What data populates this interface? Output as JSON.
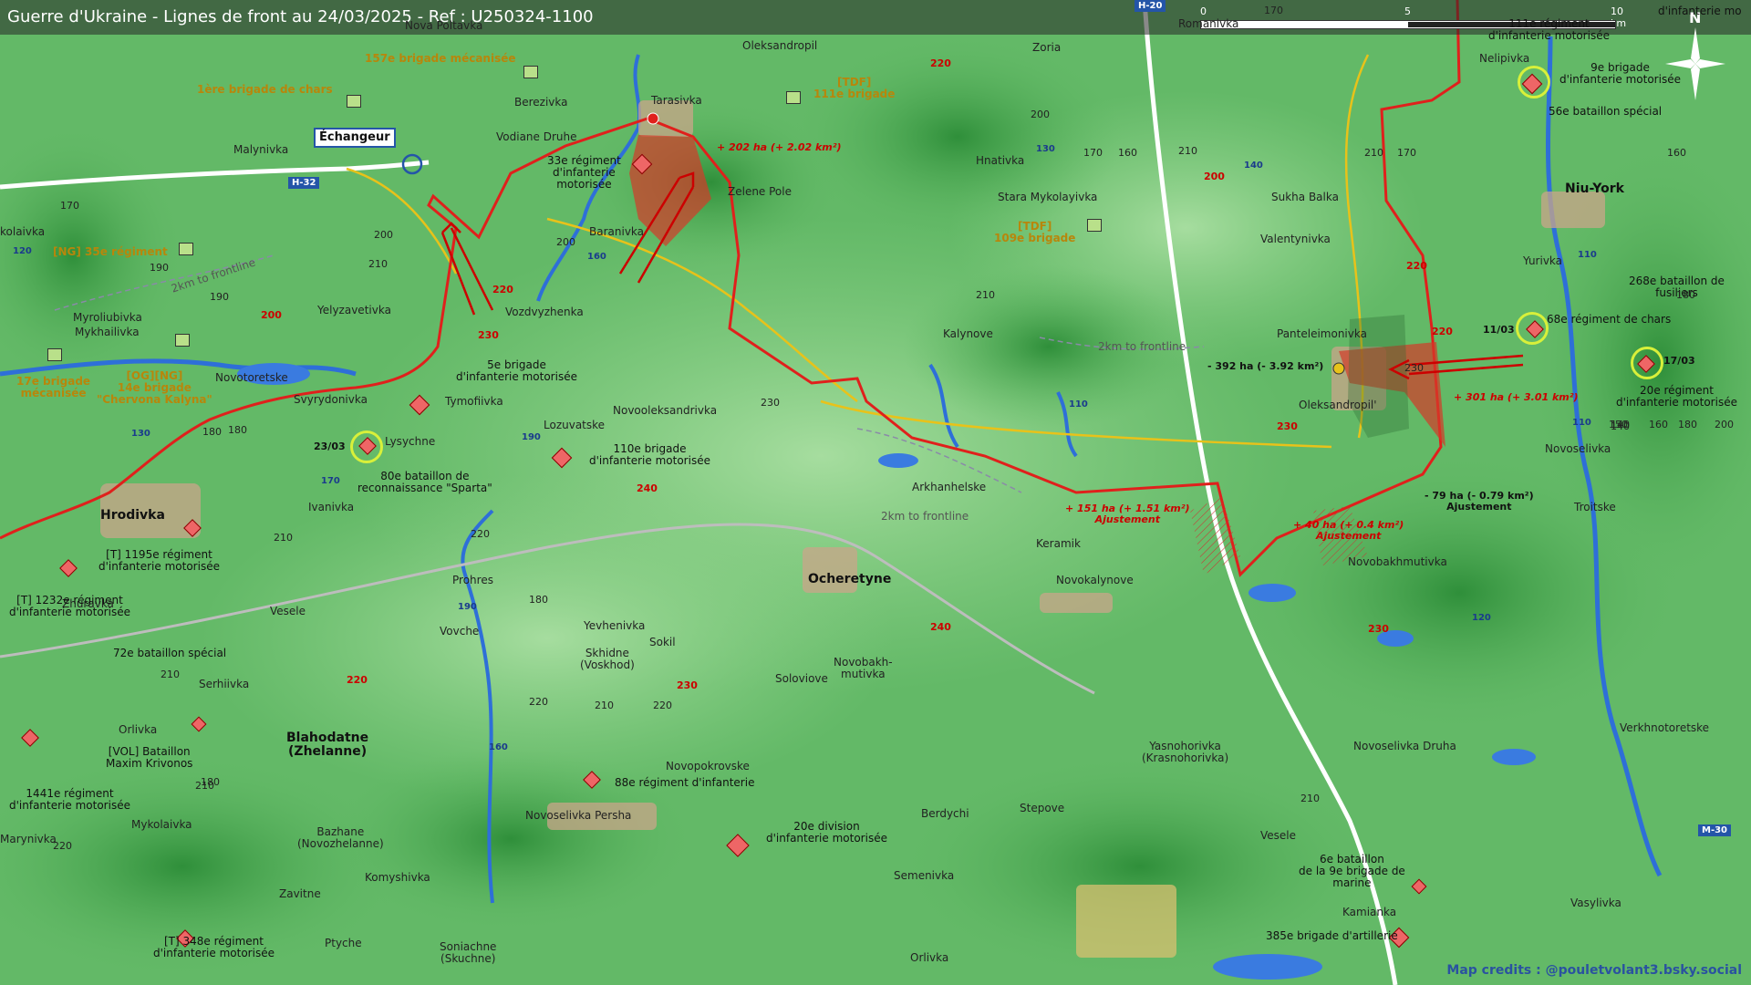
{
  "header": {
    "title": "Guerre d'Ukraine - Lignes de front au 24/03/2025 - Ref : U250324-1100"
  },
  "scale": {
    "zero": "0",
    "mid": "5",
    "end": "10 km"
  },
  "compass": {
    "north": "N"
  },
  "credits": "Map credits : @pouletvolant3.bsky.social",
  "interchange": "Échangeur",
  "road_labels": [
    {
      "id": "h32",
      "text": "H-32"
    },
    {
      "id": "h20",
      "text": "H-20"
    },
    {
      "id": "m30",
      "text": "M-30"
    }
  ],
  "towns": [
    {
      "id": "romanivka",
      "text": "Romanivka"
    },
    {
      "id": "nova-poltavka",
      "text": "Nova Poltavka"
    },
    {
      "id": "oleksandropil-n",
      "text": "Oleksandropil"
    },
    {
      "id": "zoria",
      "text": "Zoria"
    },
    {
      "id": "nelipivka",
      "text": "Nelipivka"
    },
    {
      "id": "berezivka",
      "text": "Berezivka"
    },
    {
      "id": "tarasivka",
      "text": "Tarasivka"
    },
    {
      "id": "malynivka",
      "text": "Malynivka"
    },
    {
      "id": "vodiane",
      "text": "Vodiane Druhe"
    },
    {
      "id": "zelene",
      "text": "Zelene Pole"
    },
    {
      "id": "hnativka",
      "text": "Hnativka"
    },
    {
      "id": "stara-myk",
      "text": "Stara Mykolayivka"
    },
    {
      "id": "sukha",
      "text": "Sukha Balka"
    },
    {
      "id": "valentynivka",
      "text": "Valentynivka"
    },
    {
      "id": "yurivka",
      "text": "Yurivka"
    },
    {
      "id": "baranivka",
      "text": "Baranivka"
    },
    {
      "id": "vozdvyzh",
      "text": "Vozdvyzhenka"
    },
    {
      "id": "yelyzav",
      "text": "Yelyzavetivka"
    },
    {
      "id": "myrolub",
      "text": "Myroliubivka"
    },
    {
      "id": "mykhailivka",
      "text": "Mykhailivka"
    },
    {
      "id": "kalynove",
      "text": "Kalynove"
    },
    {
      "id": "panteleim",
      "text": "Panteleimonivka"
    },
    {
      "id": "novotoretske",
      "text": "Novotoretske"
    },
    {
      "id": "svyrydonivka",
      "text": "Svyrydonivka"
    },
    {
      "id": "tymofiivka",
      "text": "Tymofiivka"
    },
    {
      "id": "novooleks",
      "text": "Novooleksandrivka"
    },
    {
      "id": "oleksandropil-e",
      "text": "Oleksandropil'"
    },
    {
      "id": "lozuvatske",
      "text": "Lozuvatske"
    },
    {
      "id": "lysychne",
      "text": "Lysychne"
    },
    {
      "id": "novoselivka",
      "text": "Novoselivka"
    },
    {
      "id": "arkhanh",
      "text": "Arkhanhelske"
    },
    {
      "id": "ivanivka",
      "text": "Ivanivka"
    },
    {
      "id": "troitske",
      "text": "Troitske"
    },
    {
      "id": "keramik",
      "text": "Keramik"
    },
    {
      "id": "novokalynove",
      "text": "Novokalynove"
    },
    {
      "id": "novobakh",
      "text": "Novobakhmutivka"
    },
    {
      "id": "prohres",
      "text": "Prohres"
    },
    {
      "id": "vesele-w",
      "text": "Vesele"
    },
    {
      "id": "zhuravka",
      "text": "Zhuravka"
    },
    {
      "id": "vovche",
      "text": "Vovche"
    },
    {
      "id": "yevhenivka",
      "text": "Yevhenivka"
    },
    {
      "id": "sokil",
      "text": "Sokil"
    },
    {
      "id": "skhidne",
      "text": "Skhidne\n(Voskhod)"
    },
    {
      "id": "novobakh-m",
      "text": "Novobakh-\nmutivka"
    },
    {
      "id": "soloviove",
      "text": "Soloviove"
    },
    {
      "id": "serhiivka",
      "text": "Serhiivka"
    },
    {
      "id": "orlivka-w",
      "text": "Orlivka"
    },
    {
      "id": "novopokr",
      "text": "Novopokrovske"
    },
    {
      "id": "yasnohor",
      "text": "Yasnohorivka\n(Krasnohorivka)"
    },
    {
      "id": "novos-druha",
      "text": "Novoselivka Druha"
    },
    {
      "id": "verkhnotor",
      "text": "Verkhnotoretske"
    },
    {
      "id": "novos-persha",
      "text": "Novoselivka Persha"
    },
    {
      "id": "mykolaivka",
      "text": "Mykolaivka"
    },
    {
      "id": "berdychi",
      "text": "Berdychi"
    },
    {
      "id": "stepove",
      "text": "Stepove"
    },
    {
      "id": "bazhane",
      "text": "Bazhane\n(Novozhelanne)"
    },
    {
      "id": "vesele-e",
      "text": "Vesele"
    },
    {
      "id": "semenivka",
      "text": "Semenivka"
    },
    {
      "id": "marynivka",
      "text": "Marynivka"
    },
    {
      "id": "komyshivka",
      "text": "Komyshivka"
    },
    {
      "id": "zavitne",
      "text": "Zavitne"
    },
    {
      "id": "kamianka",
      "text": "Kamianka"
    },
    {
      "id": "vasylivka",
      "text": "Vasylivka"
    },
    {
      "id": "ptyche",
      "text": "Ptyche"
    },
    {
      "id": "soniachne",
      "text": "Soniachne\n(Skuchne)"
    },
    {
      "id": "orlivka-s",
      "text": "Orlivka"
    },
    {
      "id": "kolaivka",
      "text": "kolaivka"
    }
  ],
  "big_towns": [
    {
      "id": "niu-york",
      "text": "Niu-York"
    },
    {
      "id": "hrodivka",
      "text": "Hrodivka"
    },
    {
      "id": "ocheretyne",
      "text": "Ocheretyne"
    },
    {
      "id": "blahodatne",
      "text": "Blahodatne\n(Zhelanne)"
    }
  ],
  "units_ru": [
    {
      "id": "u111e",
      "text": "111e régiment\nd'infanterie motorisée"
    },
    {
      "id": "u9e",
      "text": "9e brigade\nd'infanterie motorisée"
    },
    {
      "id": "u56e",
      "text": "56e bataillon spécial"
    },
    {
      "id": "u33e",
      "text": "33e régiment\nd'infanterie\nmotorisée"
    },
    {
      "id": "u268e",
      "text": "268e bataillon de\nfusiliers"
    },
    {
      "id": "u68e",
      "text": "68e régiment de chars"
    },
    {
      "id": "u20e-reg",
      "text": "20e régiment\nd'infanterie motorisée"
    },
    {
      "id": "u5e",
      "text": "5e brigade\nd'infanterie motorisée"
    },
    {
      "id": "u110e",
      "text": "110e brigade\nd'infanterie motorisée"
    },
    {
      "id": "u80e",
      "text": "80e bataillon de\nreconnaissance \"Sparta\""
    },
    {
      "id": "u1195e",
      "text": "[T] 1195e régiment\nd'infanterie motorisée"
    },
    {
      "id": "u1232e",
      "text": "[T] 1232e régiment\nd'infanterie motorisée"
    },
    {
      "id": "u72e",
      "text": "72e bataillon spécial"
    },
    {
      "id": "uvol",
      "text": "[VOL] Bataillon\nMaxim Krivonos"
    },
    {
      "id": "u1441e",
      "text": "1441e régiment\nd'infanterie motorisée"
    },
    {
      "id": "u88e",
      "text": "88e régiment d'infanterie"
    },
    {
      "id": "u20e-div",
      "text": "20e division\nd'infanterie motorisée"
    },
    {
      "id": "u6e",
      "text": "6e bataillon\nde la 9e brigade de\nmarine"
    },
    {
      "id": "u385e",
      "text": "385e brigade d'artillerie"
    },
    {
      "id": "u348e",
      "text": "[T] 348e régiment\nd'infanterie motorisée"
    },
    {
      "id": "u-ne",
      "text": "d'infanterie mo"
    }
  ],
  "units_ua": [
    {
      "id": "ua157",
      "text": "157e brigade mécanisée"
    },
    {
      "id": "ua1ere",
      "text": "1ère brigade de chars"
    },
    {
      "id": "ua111",
      "text": "[TDF]\n111e brigade"
    },
    {
      "id": "ua109",
      "text": "[TDF]\n109e brigade"
    },
    {
      "id": "ua35",
      "text": "[NG] 35e régiment"
    },
    {
      "id": "ua17",
      "text": "17e brigade\nmécanisée"
    },
    {
      "id": "ua14",
      "text": "[OG][NG]\n14e brigade\n\"Chervona Kalyna\""
    }
  ],
  "gains": [
    {
      "id": "g202",
      "text": "+ 202 ha (+ 2.02 km²)"
    },
    {
      "id": "g301",
      "text": "+ 301 ha (+ 3.01 km²)"
    },
    {
      "id": "g151",
      "text": "+ 151 ha (+ 1.51 km²)\nAjustement"
    },
    {
      "id": "g40",
      "text": "+ 40 ha (+ 0.4 km²)\nAjustement"
    }
  ],
  "losses": [
    {
      "id": "l392",
      "text": "- 392 ha (- 3.92 km²)"
    },
    {
      "id": "l79",
      "text": "- 79 ha (- 0.79 km²)\nAjustement"
    }
  ],
  "dates": [
    {
      "id": "d2303",
      "text": "23/03"
    },
    {
      "id": "d1103",
      "text": "11/03"
    },
    {
      "id": "d1703",
      "text": "17/03"
    }
  ],
  "frontline_labels": [
    {
      "id": "f1",
      "text": "2km to frontline"
    },
    {
      "id": "f2",
      "text": "2km to frontline"
    },
    {
      "id": "f3",
      "text": "2km to frontline"
    }
  ],
  "elevations_red": [
    "220",
    "200",
    "220",
    "200",
    "220",
    "230",
    "240",
    "240",
    "230",
    "220",
    "230",
    "230",
    "220"
  ],
  "elevations_blue": [
    "130",
    "140",
    "120",
    "160",
    "190",
    "110",
    "170",
    "110",
    "130",
    "190",
    "160",
    "120",
    "110"
  ],
  "elevations": [
    "170",
    "170",
    "190",
    "200",
    "210",
    "190",
    "180",
    "170",
    "160",
    "150",
    "200",
    "170",
    "230",
    "210",
    "230",
    "140",
    "160",
    "180",
    "210",
    "220",
    "180",
    "210",
    "220",
    "210",
    "220",
    "210",
    "200",
    "210",
    "180",
    "220",
    "210",
    "140",
    "160",
    "180",
    "200",
    "210",
    "180"
  ],
  "colors": {
    "frontline": "#e0201c",
    "gain_fill": "#d43a2a",
    "ua_accent": "#e8c21a",
    "road_blue": "#2455a8",
    "terrain_low": "#8fd48a",
    "terrain_high": "#2e8a3a"
  }
}
